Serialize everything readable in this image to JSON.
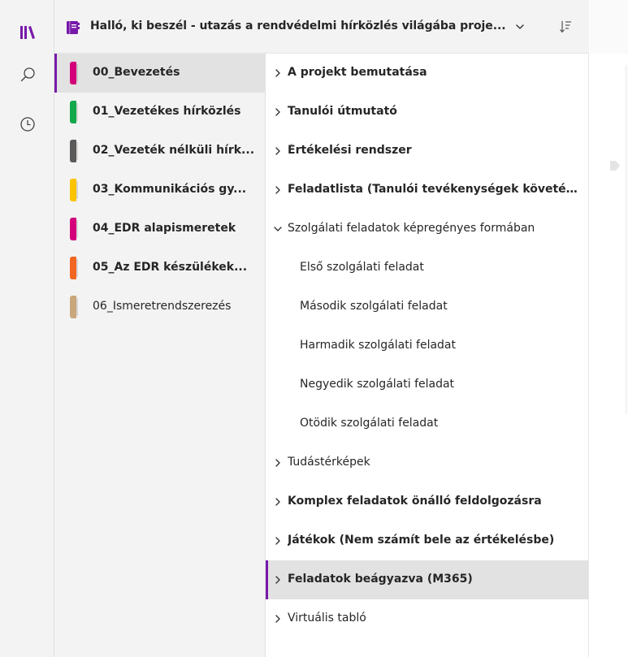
{
  "colors": {
    "accent": "#7719aa",
    "notebook_icon": "#7719aa",
    "selected_bg": "#e2e2e2"
  },
  "rail": {
    "items": [
      {
        "icon": "notebooks-library-icon"
      },
      {
        "icon": "search-icon"
      },
      {
        "icon": "recent-clock-icon"
      }
    ]
  },
  "header": {
    "notebook_icon": "notebook-icon",
    "title": "Halló, ki beszél - utazás a rendvédelmi hírközlés világába proje...",
    "chevron_icon": "chevron-down-icon",
    "sort_icon": "sort-icon"
  },
  "sections": [
    {
      "label": "00_Bevezetés",
      "color": "#d40079",
      "selected": true,
      "bold": true
    },
    {
      "label": "01_Vezetékes hírközlés",
      "color": "#13a84b",
      "selected": false,
      "bold": true
    },
    {
      "label": "02_Vezeték nélküli hírk...",
      "color": "#5c5a58",
      "selected": false,
      "bold": true
    },
    {
      "label": "03_Kommunikációs gy...",
      "color": "#fdc300",
      "selected": false,
      "bold": true
    },
    {
      "label": "04_EDR alapismeretek",
      "color": "#d40079",
      "selected": false,
      "bold": true
    },
    {
      "label": "05_Az EDR készülékek...",
      "color": "#f26522",
      "selected": false,
      "bold": true
    },
    {
      "label": "06_Ismeretrendszerezés",
      "color": "#c8a77d",
      "selected": false,
      "bold": false
    }
  ],
  "pages": [
    {
      "label": "A projekt bemutatása",
      "expander": "chevron-right-icon",
      "bold": true,
      "sub": false,
      "selected": false
    },
    {
      "label": "Tanulói útmutató",
      "expander": "chevron-right-icon",
      "bold": true,
      "sub": false,
      "selected": false
    },
    {
      "label": "Értékelési rendszer",
      "expander": "chevron-right-icon",
      "bold": true,
      "sub": false,
      "selected": false
    },
    {
      "label": "Feladatlista (Tanulói tevékenységek követés...",
      "expander": "chevron-right-icon",
      "bold": true,
      "sub": false,
      "selected": false
    },
    {
      "label": "Szolgálati feladatok képregényes formában",
      "expander": "chevron-down-icon",
      "bold": false,
      "sub": false,
      "selected": false
    },
    {
      "label": "Első szolgálati feladat",
      "expander": "",
      "bold": false,
      "sub": true,
      "selected": false
    },
    {
      "label": "Második szolgálati feladat",
      "expander": "",
      "bold": false,
      "sub": true,
      "selected": false
    },
    {
      "label": "Harmadik szolgálati feladat",
      "expander": "",
      "bold": false,
      "sub": true,
      "selected": false
    },
    {
      "label": "Negyedik szolgálati feladat",
      "expander": "",
      "bold": false,
      "sub": true,
      "selected": false
    },
    {
      "label": "Ötödik szolgálati feladat",
      "expander": "",
      "bold": false,
      "sub": true,
      "selected": false
    },
    {
      "label": "Tudástérképek",
      "expander": "chevron-right-icon",
      "bold": false,
      "sub": false,
      "selected": false
    },
    {
      "label": "Komplex feladatok önálló feldolgozásra",
      "expander": "chevron-right-icon",
      "bold": true,
      "sub": false,
      "selected": false
    },
    {
      "label": "Játékok (Nem számít bele az értékelésbe)",
      "expander": "chevron-right-icon",
      "bold": true,
      "sub": false,
      "selected": false
    },
    {
      "label": "Feladatok beágyazva (M365)",
      "expander": "chevron-right-icon",
      "bold": true,
      "sub": false,
      "selected": true
    },
    {
      "label": "Virtuális tabló",
      "expander": "chevron-right-icon",
      "bold": false,
      "sub": false,
      "selected": false
    }
  ],
  "canvas": {
    "expand_icon": "expand-arrow-icon"
  }
}
